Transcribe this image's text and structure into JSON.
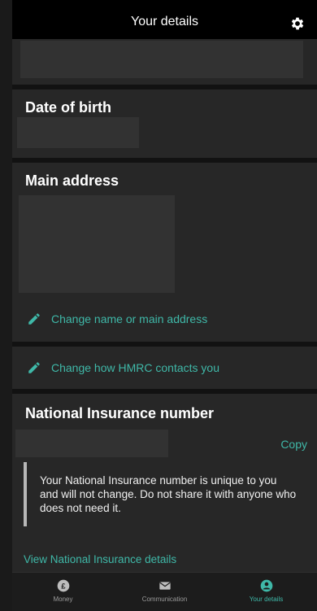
{
  "header": {
    "title": "Your details",
    "settings_icon": "gear-icon"
  },
  "sections": {
    "dob": {
      "title": "Date of birth"
    },
    "address": {
      "title": "Main address",
      "change_link": "Change name or main address"
    },
    "contacts": {
      "change_link": "Change how HMRC contacts you"
    },
    "nino": {
      "title": "National Insurance number",
      "copy_label": "Copy",
      "info_text": "Your National Insurance number is unique to you and will not change. Do not share it with anyone who does not need it.",
      "view_link": "View National Insurance details"
    }
  },
  "tabs": [
    {
      "label": "Money",
      "icon": "pound-icon"
    },
    {
      "label": "Communication",
      "icon": "envelope-icon"
    },
    {
      "label": "Your details",
      "icon": "person-icon",
      "active": true
    }
  ],
  "colors": {
    "accent": "#3fb8a8",
    "card": "#272727",
    "background": "#121212"
  }
}
